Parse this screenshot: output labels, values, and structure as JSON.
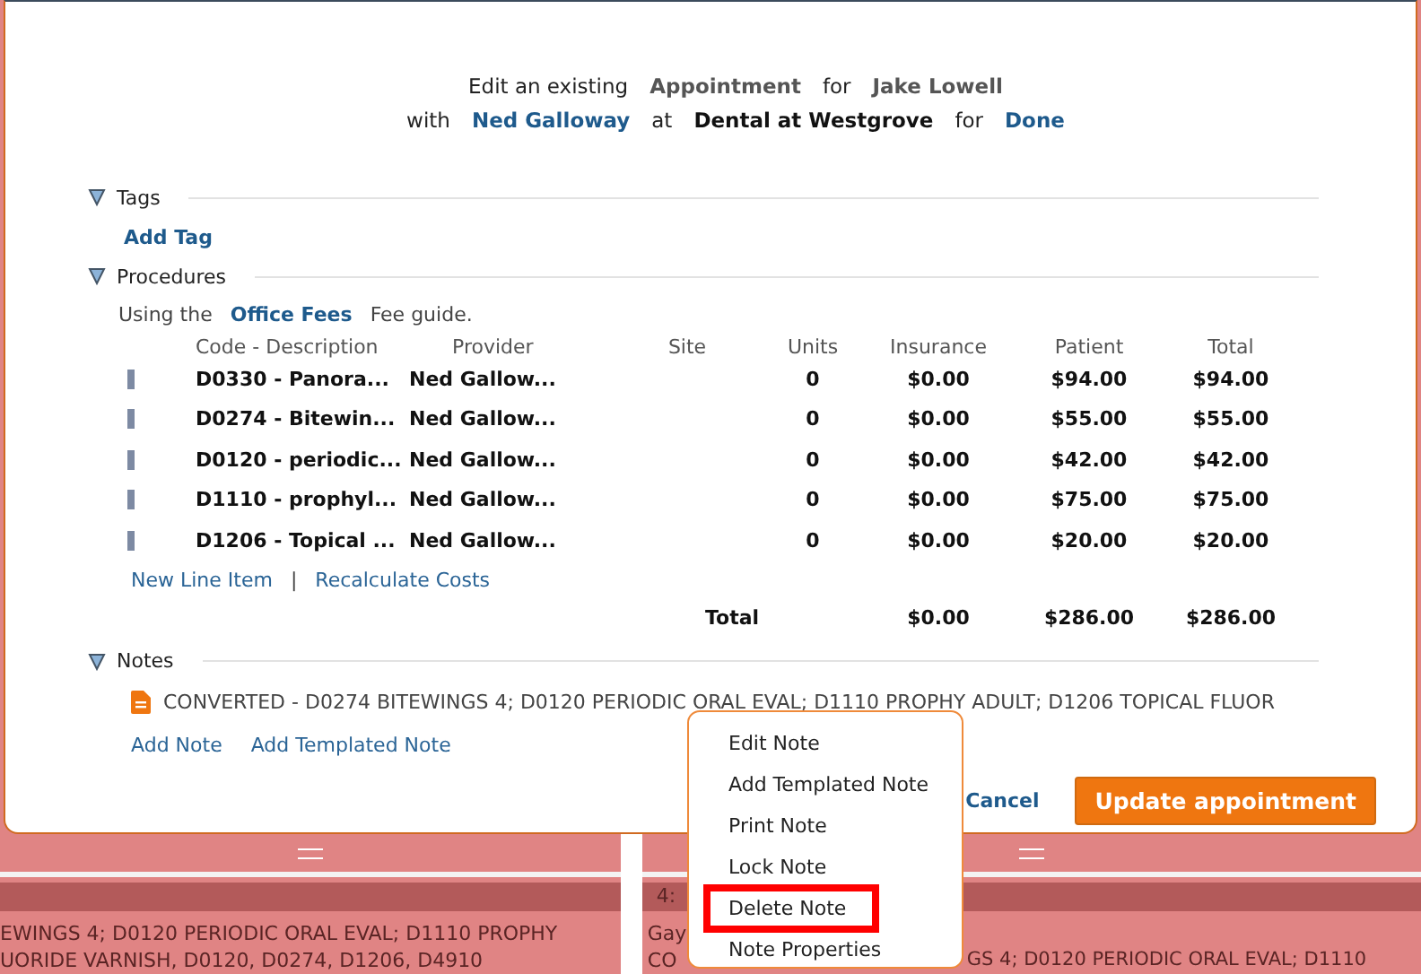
{
  "header": {
    "line1": [
      {
        "text": "Edit an existing",
        "kind": "plain"
      },
      {
        "text": "Appointment",
        "kind": "strong"
      },
      {
        "text": "for",
        "kind": "plain"
      },
      {
        "text": "Jake Lowell",
        "kind": "strong"
      }
    ],
    "line2": [
      {
        "text": "with",
        "kind": "plain"
      },
      {
        "text": "Ned Galloway",
        "kind": "link"
      },
      {
        "text": "at",
        "kind": "plain"
      },
      {
        "text": "Dental at Westgrove",
        "kind": "dark"
      },
      {
        "text": "for",
        "kind": "plain"
      },
      {
        "text": "Done",
        "kind": "link"
      }
    ]
  },
  "tags": {
    "title": "Tags",
    "expanded": true,
    "add_link": "Add Tag"
  },
  "procedures": {
    "title": "Procedures",
    "expanded": true,
    "guide_prefix": "Using the",
    "guide_name": "Office Fees",
    "guide_suffix": "Fee guide.",
    "columns": [
      "Code - Description",
      "Provider",
      "Site",
      "Units",
      "Insurance",
      "Patient",
      "Total"
    ],
    "rows": [
      {
        "code": "D0330 - Panora...",
        "provider": "Ned Gallow...",
        "units": "0",
        "insurance": "$0.00",
        "patient": "$94.00",
        "total": "$94.00"
      },
      {
        "code": "D0274 - Bitewin...",
        "provider": "Ned Gallow...",
        "units": "0",
        "insurance": "$0.00",
        "patient": "$55.00",
        "total": "$55.00"
      },
      {
        "code": "D0120 - periodic...",
        "provider": "Ned Gallow...",
        "units": "0",
        "insurance": "$0.00",
        "patient": "$42.00",
        "total": "$42.00"
      },
      {
        "code": "D1110 - prophyl...",
        "provider": "Ned Gallow...",
        "units": "0",
        "insurance": "$0.00",
        "patient": "$75.00",
        "total": "$75.00"
      },
      {
        "code": "D1206 - Topical ...",
        "provider": "Ned Gallow...",
        "units": "0",
        "insurance": "$0.00",
        "patient": "$20.00",
        "total": "$20.00"
      }
    ],
    "links": [
      "New Line Item",
      "Recalculate Costs"
    ],
    "separator": "|",
    "totals": {
      "label": "Total",
      "insurance": "$0.00",
      "patient": "$286.00",
      "total": "$286.00"
    }
  },
  "notes": {
    "title": "Notes",
    "expanded": true,
    "items": [
      "CONVERTED - D0274 BITEWINGS 4; D0120 PERIODIC ORAL EVAL; D1110 PROPHY ADULT; D1206 TOPICAL FLUOR"
    ],
    "links": [
      "Add Note",
      "Add Templated Note"
    ]
  },
  "buttons": {
    "cancel": "Cancel",
    "submit": "Update appointment"
  },
  "context_menu": {
    "items": [
      {
        "label": "Edit Note",
        "highlighted": false
      },
      {
        "label": "Add Templated Note",
        "highlighted": false
      },
      {
        "label": "Print Note",
        "highlighted": false
      },
      {
        "label": "Lock Note",
        "highlighted": false
      },
      {
        "label": "Delete Note",
        "highlighted": true
      },
      {
        "label": "Note Properties",
        "highlighted": false
      }
    ]
  },
  "calendar": {
    "left_lines": [
      "EWINGS 4; D0120 PERIODIC ORAL EVAL; D1110 PROPHY",
      "UORIDE VARNISH, D0120, D0274, D1206, D4910"
    ],
    "right_time": "4:",
    "right_lines": [
      "Gay",
      "CO"
    ],
    "right_tail": "GS 4; D0120 PERIODIC ORAL EVAL; D1110"
  }
}
